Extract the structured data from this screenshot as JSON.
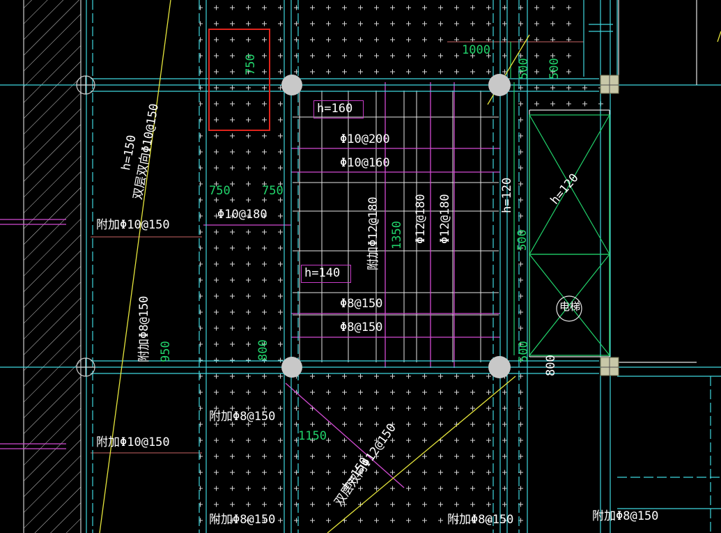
{
  "colors": {
    "background": "#000000",
    "text_white": "#ffffff",
    "dimension_green": "#21d36b",
    "slab_magenta": "#e24be0",
    "axis_cyan": "#3fd8e0",
    "selection_red": "#e0241c",
    "column_gray": "#c8c8c8"
  },
  "annotations": {
    "h_160": "h=160",
    "h_140": "h=140",
    "h_150_left": "h=150",
    "h_150_bottom": "h=150",
    "h_120": "h=120",
    "h_120_vertical": "h=120",
    "rebar_10_200": "Φ10@200",
    "rebar_10_160": "Φ10@160",
    "rebar_10_180": "Φ10@180",
    "rebar_8_150_a": "Φ8@150",
    "rebar_8_150_b": "Φ8@150",
    "rebar_12_180_a": "Φ12@180",
    "rebar_12_180_b": "Φ12@180",
    "add_12_180": "附加Φ12@180",
    "add_10_150_top": "附加Φ10@150",
    "add_10_150_bottom": "附加Φ10@150",
    "add_8_150_vertical": "附加Φ8@150",
    "add_8_150_mid": "附加Φ8@150",
    "add_8_150_bottom_left": "附加Φ8@150",
    "add_8_150_bottom_mid": "附加Φ8@150",
    "add_8_150_bottom_right": "附加Φ8@150",
    "double_10_150": "双层双向Φ10@150",
    "double_12_150": "双层双向Φ12@150",
    "elevator": "电梯"
  },
  "dimensions": {
    "d750_box": "750",
    "d1000": "1000",
    "d500_a": "500",
    "d500_b": "500",
    "d750_left": "750",
    "d750_right": "750",
    "d1350": "1350",
    "d500_c": "500",
    "d950": "950",
    "d800": "800",
    "d500_d": "500",
    "d800_right": "800",
    "d1150": "1150"
  }
}
